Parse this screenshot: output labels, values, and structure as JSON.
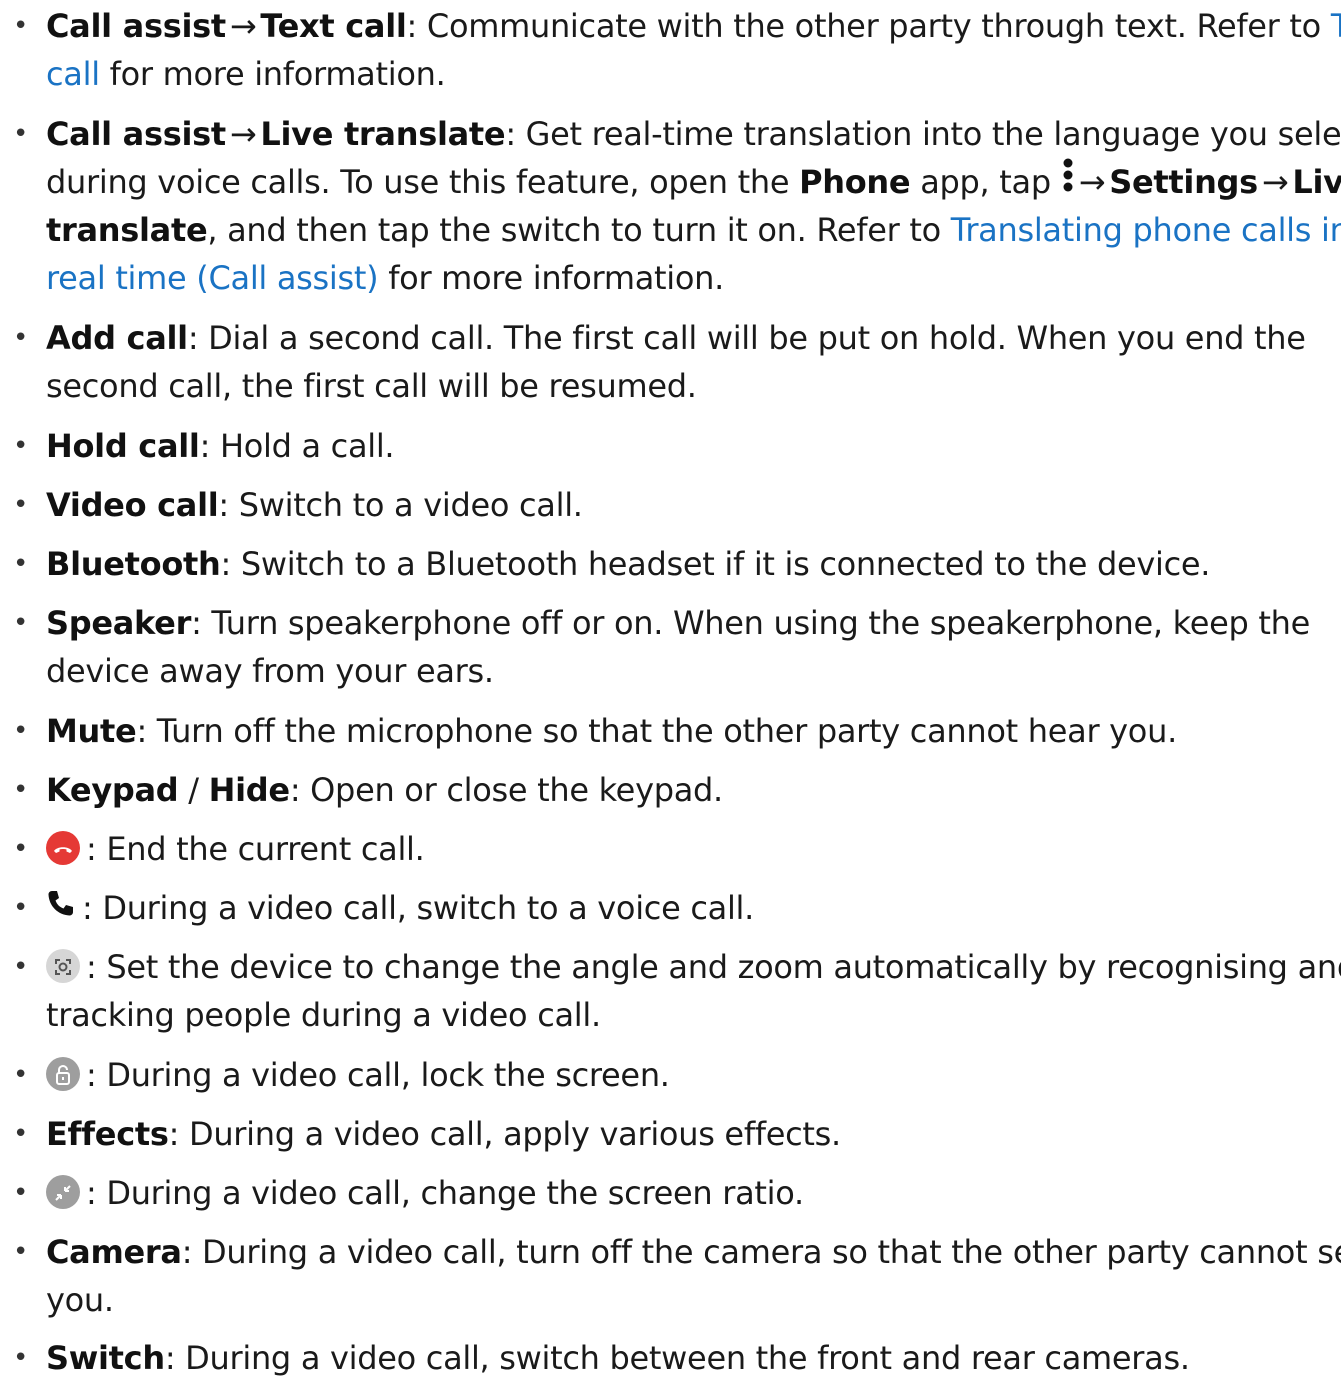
{
  "items": [
    {
      "lines": [
        {
          "b1": "Call assist",
          "arrow": "→",
          "b2": "Text call",
          "t1": ": Communicate with the other party through text. Refer to ",
          "link": "Text"
        },
        {
          "link": "call",
          "t1": " for more information."
        }
      ]
    },
    {
      "lines": [
        {
          "b1": "Call assist",
          "arrow": "→",
          "b2": "Live translate",
          "t1": ": Get real-time translation into the language you select"
        },
        {
          "t1": "during voice calls. To use this feature, open the ",
          "b1": "Phone",
          "t2": " app, tap ",
          "arrow1": "→",
          "b2": "Settings",
          "arrow2": "→",
          "b3": "Live"
        },
        {
          "b1": "translate",
          "t1": ", and then tap the switch to turn it on. Refer to ",
          "link": "Translating phone calls in"
        },
        {
          "link": "real time (Call assist)",
          "t1": " for more information."
        }
      ]
    },
    {
      "lines": [
        {
          "b1": "Add call",
          "t1": ": Dial a second call. The first call will be put on hold. When you end the"
        },
        {
          "t1": "second call, the first call will be resumed."
        }
      ]
    },
    {
      "lines": [
        {
          "b1": "Hold call",
          "t1": ": Hold a call."
        }
      ]
    },
    {
      "lines": [
        {
          "b1": "Video call",
          "t1": ": Switch to a video call."
        }
      ]
    },
    {
      "lines": [
        {
          "b1": "Bluetooth",
          "t1": ": Switch to a Bluetooth headset if it is connected to the device."
        }
      ]
    },
    {
      "lines": [
        {
          "b1": "Speaker",
          "t1": ": Turn speakerphone off or on. When using the speakerphone, keep the"
        },
        {
          "t1": "device away from your ears."
        }
      ]
    },
    {
      "lines": [
        {
          "b1": "Mute",
          "t1": ": Turn off the microphone so that the other party cannot hear you."
        }
      ]
    },
    {
      "lines": [
        {
          "b1": "Keypad",
          "sep": " / ",
          "b2": "Hide",
          "t1": ": Open or close the keypad."
        }
      ]
    },
    {
      "lines": [
        {
          "icon": "end-call-icon",
          "t1": ": End the current call."
        }
      ]
    },
    {
      "lines": [
        {
          "icon": "voice-call-icon",
          "t1": ": During a video call, switch to a voice call."
        }
      ]
    },
    {
      "lines": [
        {
          "icon": "auto-framing-icon",
          "t1": ": Set the device to change the angle and zoom automatically by recognising and"
        },
        {
          "t1": "tracking people during a video call."
        }
      ]
    },
    {
      "lines": [
        {
          "icon": "lock-screen-icon",
          "t1": ": During a video call, lock the screen."
        }
      ]
    },
    {
      "lines": [
        {
          "b1": "Effects",
          "t1": ": During a video call, apply various effects."
        }
      ]
    },
    {
      "lines": [
        {
          "icon": "screen-ratio-icon",
          "t1": ": During a video call, change the screen ratio."
        }
      ]
    },
    {
      "lines": [
        {
          "b1": "Camera",
          "t1": ": During a video call, turn off the camera so that the other party cannot see"
        },
        {
          "t1": "you."
        }
      ]
    },
    {
      "lines": [
        {
          "b1": "Switch",
          "t1": ": During a video call, switch between the front and rear cameras."
        }
      ]
    }
  ],
  "bullet": "•",
  "colors": {
    "link": "#1a73c4",
    "end_call": "#e53935",
    "icon_grey": "#9e9e9e"
  }
}
